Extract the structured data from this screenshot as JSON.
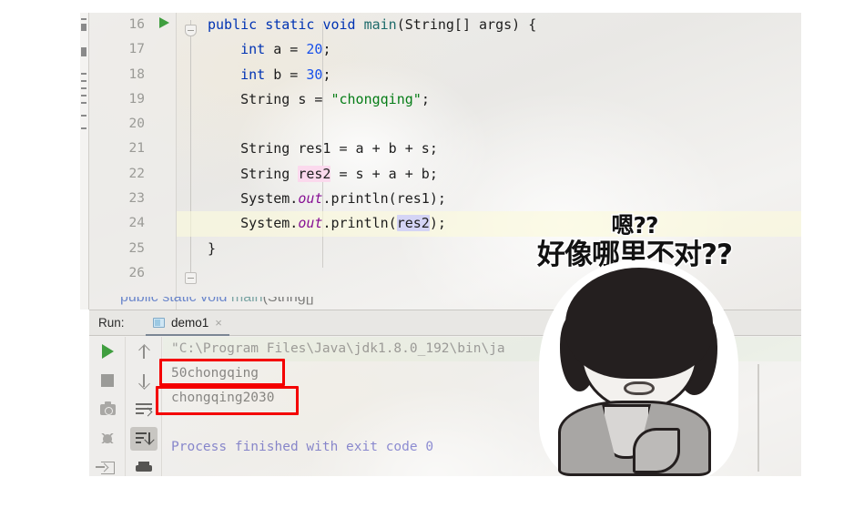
{
  "editor": {
    "lines": [
      {
        "no": "16",
        "has_run_marker": true,
        "current": false,
        "text": "public static void main(String[] args) {"
      },
      {
        "no": "17",
        "has_run_marker": false,
        "current": false,
        "text": "    int a = 20;"
      },
      {
        "no": "18",
        "has_run_marker": false,
        "current": false,
        "text": "    int b = 30;"
      },
      {
        "no": "19",
        "has_run_marker": false,
        "current": false,
        "text": "    String s = \"chongqing\";"
      },
      {
        "no": "20",
        "has_run_marker": false,
        "current": false,
        "text": ""
      },
      {
        "no": "21",
        "has_run_marker": false,
        "current": false,
        "text": "    String res1 = a + b + s;"
      },
      {
        "no": "22",
        "has_run_marker": false,
        "current": false,
        "text": "    String res2 = s + a + b;"
      },
      {
        "no": "23",
        "has_run_marker": false,
        "current": false,
        "text": "    System.out.println(res1);"
      },
      {
        "no": "24",
        "has_run_marker": false,
        "current": true,
        "text": "    System.out.println(res2);"
      },
      {
        "no": "25",
        "has_run_marker": false,
        "current": false,
        "text": "}"
      },
      {
        "no": "26",
        "has_run_marker": false,
        "current": false,
        "text": ""
      }
    ],
    "run_marker_icon": "run-triangle-icon",
    "fold_icon": "code-fold-icon"
  },
  "run_panel": {
    "label": "Run:",
    "tab": {
      "name": "demo1",
      "icon": "run-config-icon",
      "close": "×"
    },
    "left_tools": [
      {
        "name": "rerun-button",
        "icon": "play-icon"
      },
      {
        "name": "stop-button",
        "icon": "stop-icon"
      },
      {
        "name": "screenshot-button",
        "icon": "camera-icon"
      },
      {
        "name": "debug-button",
        "icon": "bug-icon"
      },
      {
        "name": "export-button",
        "icon": "export-icon"
      }
    ],
    "right_tools": [
      {
        "name": "scroll-up-button",
        "icon": "arrow-up-icon"
      },
      {
        "name": "scroll-down-button",
        "icon": "arrow-down-icon"
      },
      {
        "name": "soft-wrap-button",
        "icon": "soft-wrap-icon"
      },
      {
        "name": "scroll-to-end-button",
        "icon": "scroll-end-icon",
        "selected": true
      },
      {
        "name": "print-button",
        "icon": "printer-icon"
      }
    ],
    "console": [
      {
        "type": "cmd",
        "text": "\"C:\\Program Files\\Java\\jdk1.8.0_192\\bin\\ja"
      },
      {
        "type": "out",
        "text": "50chongqing"
      },
      {
        "type": "out",
        "text": "chongqing2030"
      },
      {
        "type": "blank",
        "text": ""
      },
      {
        "type": "exit",
        "text": "Process finished with exit code 0"
      }
    ]
  },
  "annotations": {
    "box_color": "#f40000",
    "boxes": [
      {
        "name": "highlight-box-output-1",
        "target": "50chongqing"
      },
      {
        "name": "highlight-box-output-2",
        "target": "chongqing2030"
      }
    ]
  },
  "meme": {
    "line1": "嗯??",
    "line2": "好像哪里不对??",
    "character": "confused-cartoon-character"
  }
}
